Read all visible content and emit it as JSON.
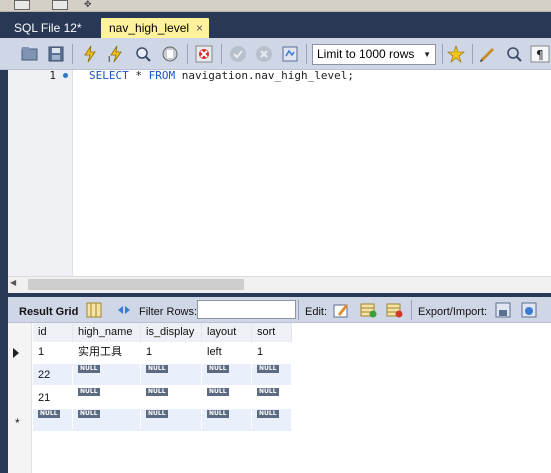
{
  "tabs": [
    {
      "label": "SQL File 12*"
    },
    {
      "label": "nav_high_level",
      "close": "×"
    }
  ],
  "toolbar": {
    "limit_label": "Limit to 1000 rows",
    "icons": [
      "open-folder-icon",
      "save-icon",
      "execute-icon",
      "execute-current-icon",
      "explain-icon",
      "stop-icon",
      "toggle-error-icon",
      "commit-icon",
      "rollback-icon",
      "autocommit-icon",
      "bookmark-icon",
      "beautify-icon",
      "find-icon",
      "invisible-chars-icon"
    ]
  },
  "editor": {
    "line_number": "1",
    "keyword_select": "SELECT",
    "star": "*",
    "keyword_from": "FROM",
    "table": "navigation.nav_high_level;"
  },
  "result_toolbar": {
    "result_grid": "Result Grid",
    "filter_rows": "Filter Rows:",
    "edit": "Edit:",
    "export_import": "Export/Import:"
  },
  "grid": {
    "columns": [
      "id",
      "high_name",
      "is_display",
      "layout",
      "sort"
    ],
    "rows": [
      {
        "id": "1",
        "high_name": "实用工具",
        "is_display": "1",
        "layout": "left",
        "sort": "1"
      },
      {
        "id": "22",
        "high_name": "NULL",
        "is_display": "NULL",
        "layout": "NULL",
        "sort": "NULL"
      },
      {
        "id": "21",
        "high_name": "NULL",
        "is_display": "NULL",
        "layout": "NULL",
        "sort": "NULL"
      },
      {
        "id": "NULL",
        "high_name": "NULL",
        "is_display": "NULL",
        "layout": "NULL",
        "sort": "NULL"
      }
    ],
    "new_row_marker": "*"
  },
  "colors": {
    "dark_frame": "#293955",
    "active_tab": "#fff29d",
    "toolbar_bg": "#cfd6e5",
    "keyword": "#1a53c7",
    "row_alt": "#eaf0fb"
  }
}
